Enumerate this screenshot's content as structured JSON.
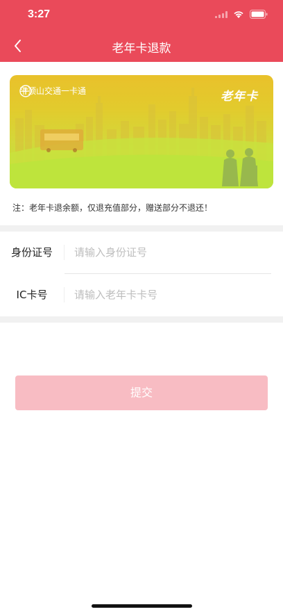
{
  "status_bar": {
    "time": "3:27"
  },
  "header": {
    "title": "老年卡退款"
  },
  "card": {
    "brand": "平顶山交通一卡通",
    "type_label": "老年卡"
  },
  "note": "注：老年卡退余额，仅退充值部分，赠送部分不退还！",
  "form": {
    "id_label": "身份证号",
    "id_placeholder": "请输入身份证号",
    "ic_label": "IC卡号",
    "ic_placeholder": "请输入老年卡卡号"
  },
  "submit_label": "提交",
  "colors": {
    "brand": "#ea4a5a",
    "button": "#f8bcc3"
  }
}
